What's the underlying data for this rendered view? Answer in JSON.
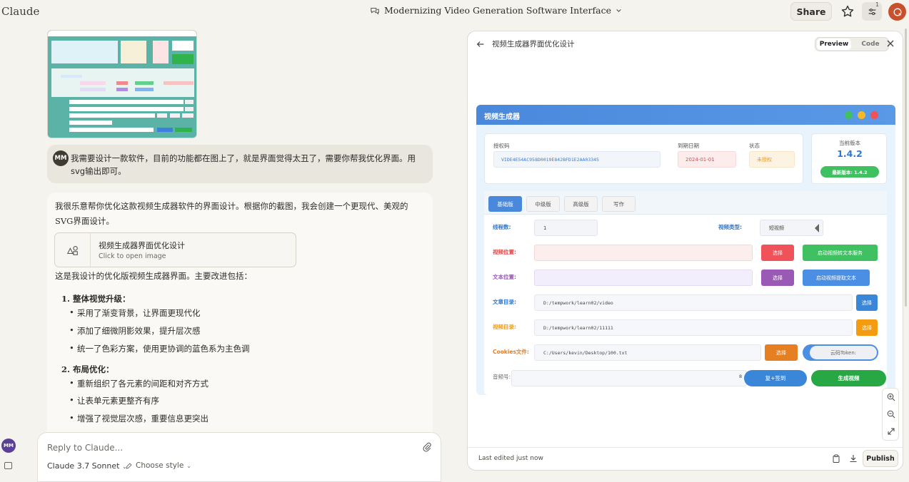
{
  "topbar": {
    "brand": "Claude",
    "conversation_title": "Modernizing Video Generation Software Interface",
    "share_label": "Share",
    "tools_count": "1"
  },
  "chat": {
    "user_initials": "MM",
    "user_message": "我需要设计一款软件，目前的功能都在图上了，就是界面觉得太丑了，需要你帮我优化界面。用svg输出即可。",
    "ai_intro": "我很乐意帮你优化这款视频生成器软件的界面设计。根据你的截图，我会创建一个更现代、美观的SVG界面设计。",
    "artifact_card": {
      "title": "视频生成器界面优化设计",
      "subtitle": "Click to open image"
    },
    "ai_para2": "这是我设计的优化版视频生成器界面。主要改进包括：",
    "sections": [
      {
        "heading": "1. 整体视觉升级：",
        "bullets": [
          "采用了渐变背景，让界面更现代化",
          "添加了细微阴影效果，提升层次感",
          "统一了色彩方案，使用更协调的蓝色系为主色调"
        ]
      },
      {
        "heading": "2. 布局优化：",
        "bullets": [
          "重新组织了各元素的间距和对齐方式",
          "让表单元素更整齐有序",
          "增强了视觉层次感，重要信息更突出"
        ]
      }
    ],
    "reply_placeholder": "Reply to Claude...",
    "model_label": "Claude 3.7 Sonnet",
    "style_label": "Choose style",
    "sidebar_initials": "MM"
  },
  "panel": {
    "title": "视频生成器界面优化设计",
    "tab_preview": "Preview",
    "tab_code": "Code",
    "last_edited": "Last edited just now",
    "publish_label": "Publish"
  },
  "app": {
    "title": "视频生成器",
    "dots": [
      "#3fc161",
      "#f4b92b",
      "#f0525a"
    ],
    "license": {
      "code_label": "授权码",
      "code_value": "VIDE4E54AC958D0019E842BFD1E2AA03345",
      "expiry_label": "到期日期",
      "expiry_value": "2024-01-01",
      "status_label": "状态",
      "status_value": "未授权"
    },
    "version": {
      "label": "当前版本",
      "number": "1.4.2",
      "latest_label": "最新版本: 1.4.2"
    },
    "tabs": [
      "基础版",
      "中级版",
      "高级版",
      "写作"
    ],
    "rows": {
      "threads_label": "线程数:",
      "threads_value": "1",
      "video_type_label": "视频类型:",
      "video_type_value": "短视频",
      "video_pos_label": "视频位置:",
      "video_pos_btn": "选择",
      "video_pos_action": "启动视频转文本服务",
      "text_pos_label": "文本位置:",
      "text_pos_btn": "选择",
      "text_pos_action": "启动视频提取文本",
      "article_dir_label": "文章目录:",
      "article_dir_value": "D:/tempwork/learn02/video",
      "article_dir_btn": "选择",
      "video_dir_label": "视频目录:",
      "video_dir_value": "D:/tempwork/learn02/11111",
      "video_dir_btn": "选择",
      "cookies_label": "Cookies文件:",
      "cookies_value": "C:/Users/kevin/Desktop/100.txt",
      "cookies_btn": "选择",
      "token_label": "云码Token:",
      "audio_label": "音频号:",
      "audio_suffix": "8",
      "sign_btn": "复+签到",
      "generate_btn": "生成视频"
    },
    "colors": {
      "blue": "#4a88dc",
      "red": "#f0525a",
      "green": "#3fc161",
      "purple": "#9b59b6",
      "orange": "#f39c12",
      "cookies_orange": "#e67e22"
    }
  }
}
